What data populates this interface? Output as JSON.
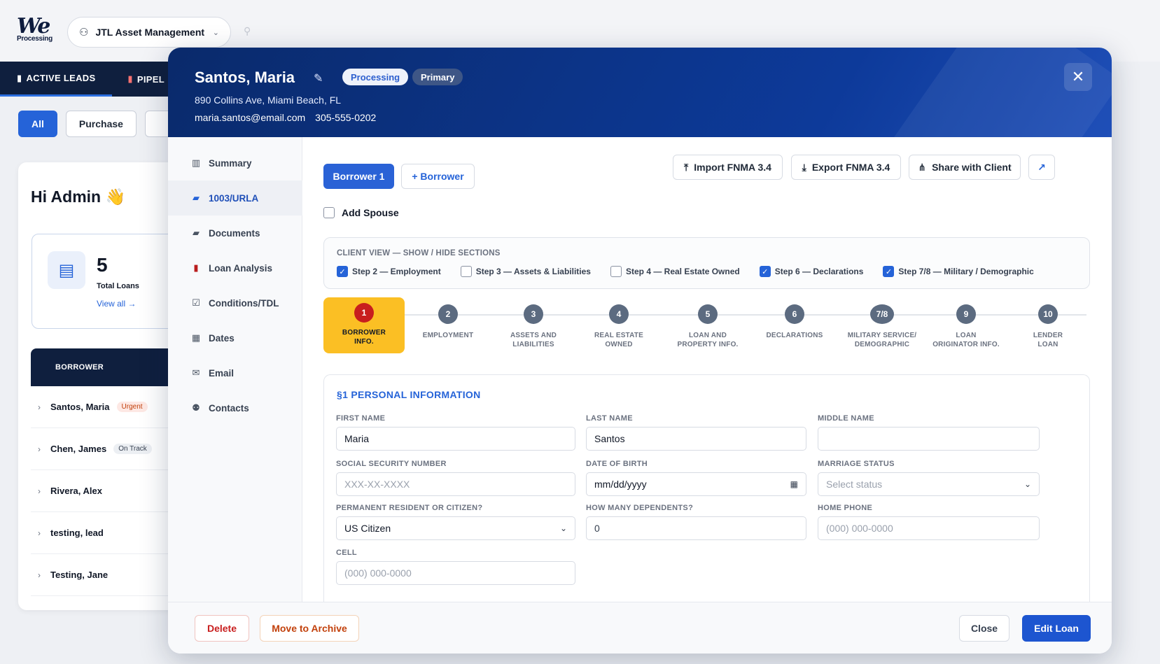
{
  "app": {
    "logo_top": "We",
    "logo_bottom": "Processing",
    "org_name": "JTL Asset Management",
    "nav": [
      {
        "label": "ACTIVE LEADS",
        "icon": "clipboard-icon"
      },
      {
        "label": "PIPEL",
        "icon": "chart-icon"
      }
    ],
    "filters": [
      "All",
      "Purchase"
    ],
    "greeting": "Hi Admin 👋",
    "stat": {
      "value": "5",
      "label": "Total Loans",
      "link": "View all →"
    },
    "leads_header": "BORROWER",
    "leads": [
      {
        "name": "Santos, Maria",
        "badge": "Urgent",
        "badge_type": "urgent"
      },
      {
        "name": "Chen, James",
        "badge": "On Track",
        "badge_type": "ontrack"
      },
      {
        "name": "Rivera, Alex",
        "badge": "",
        "badge_type": ""
      },
      {
        "name": "testing, lead",
        "badge": "",
        "badge_type": ""
      },
      {
        "name": "Testing, Jane",
        "badge": "",
        "badge_type": ""
      }
    ]
  },
  "modal": {
    "name": "Santos, Maria",
    "status_pill": "Processing",
    "role_pill": "Primary",
    "address": "890 Collins Ave, Miami Beach, FL",
    "email": "maria.santos@email.com",
    "phone": "305-555-0202",
    "sidebar": [
      {
        "label": "Summary",
        "icon": "bar-chart-icon"
      },
      {
        "label": "1003/URLA",
        "icon": "folder-icon",
        "active": true
      },
      {
        "label": "Documents",
        "icon": "document-icon"
      },
      {
        "label": "Loan Analysis",
        "icon": "chart-icon"
      },
      {
        "label": "Conditions/TDL",
        "icon": "checkbox-icon"
      },
      {
        "label": "Dates",
        "icon": "calendar-icon"
      },
      {
        "label": "Email",
        "icon": "envelope-icon"
      },
      {
        "label": "Contacts",
        "icon": "people-icon"
      }
    ],
    "toolbar": {
      "borrower_tab": "Borrower 1",
      "add_borrower": "+ Borrower",
      "import": "Import FNMA 3.4",
      "export": "Export FNMA 3.4",
      "share": "Share with Client"
    },
    "add_spouse": "Add Spouse",
    "client_view": {
      "title": "CLIENT VIEW — SHOW / HIDE SECTIONS",
      "options": [
        {
          "label": "Step 2 — Employment",
          "checked": true
        },
        {
          "label": "Step 3 — Assets & Liabilities",
          "checked": false
        },
        {
          "label": "Step 4 — Real Estate Owned",
          "checked": false
        },
        {
          "label": "Step 6 — Declarations",
          "checked": true
        },
        {
          "label": "Step 7/8 — Military / Demographic",
          "checked": true
        }
      ]
    },
    "steps": [
      {
        "num": "1",
        "line1": "BORROWER",
        "line2": "INFO."
      },
      {
        "num": "2",
        "line1": "EMPLOYMENT",
        "line2": ""
      },
      {
        "num": "3",
        "line1": "ASSETS AND",
        "line2": "LIABILITIES"
      },
      {
        "num": "4",
        "line1": "REAL ESTATE",
        "line2": "OWNED"
      },
      {
        "num": "5",
        "line1": "LOAN AND",
        "line2": "PROPERTY INFO."
      },
      {
        "num": "6",
        "line1": "DECLARATIONS",
        "line2": ""
      },
      {
        "num": "7/8",
        "line1": "MILITARY SERVICE/",
        "line2": "DEMOGRAPHIC"
      },
      {
        "num": "9",
        "line1": "LOAN",
        "line2": "ORIGINATOR INFO."
      },
      {
        "num": "10",
        "line1": "LENDER",
        "line2": "LOAN"
      }
    ],
    "personal": {
      "title": "§1 PERSONAL INFORMATION",
      "first_name_label": "FIRST NAME",
      "first_name": "Maria",
      "last_name_label": "LAST NAME",
      "last_name": "Santos",
      "middle_name_label": "MIDDLE NAME",
      "middle_name": "",
      "ssn_label": "SOCIAL SECURITY NUMBER",
      "ssn_placeholder": "XXX-XX-XXXX",
      "dob_label": "DATE OF BIRTH",
      "dob_value": "mm/dd/yyyy",
      "marriage_label": "MARRIAGE STATUS",
      "marriage_placeholder": "Select status",
      "resident_label": "PERMANENT RESIDENT OR CITIZEN?",
      "resident_value": "US Citizen",
      "dependents_label": "HOW MANY DEPENDENTS?",
      "dependents_value": "0",
      "home_phone_label": "HOME PHONE",
      "home_phone_placeholder": "(000) 000-0000",
      "cell_label": "CELL",
      "cell_placeholder": "(000) 000-0000"
    },
    "footer": {
      "delete": "Delete",
      "archive": "Move to Archive",
      "close": "Close",
      "edit": "Edit Loan"
    }
  }
}
